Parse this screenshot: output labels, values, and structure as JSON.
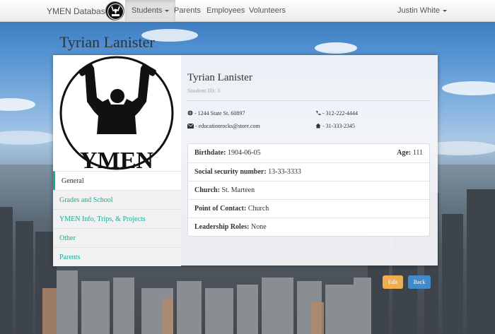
{
  "navbar": {
    "brand": "YMEN Database",
    "items": [
      {
        "label": "Students",
        "active": true,
        "dropdown": true
      },
      {
        "label": "Parents",
        "active": false
      },
      {
        "label": "Employees",
        "active": false
      },
      {
        "label": "Volunteers",
        "active": false
      }
    ],
    "user": "Justin White"
  },
  "page": {
    "title": "Tyrian Lanister"
  },
  "profile": {
    "name": "Tyrian Lanister",
    "student_id": "Student ID: 3",
    "address": "- 1244 State St. 60897",
    "email": "- educationrocks@store.com",
    "phone": "- 312-222-4444",
    "home_phone": "- 31-333-2345"
  },
  "logo_text": "YMEN",
  "side_menu": [
    {
      "label": "General",
      "active": true
    },
    {
      "label": "Grades and School",
      "active": false
    },
    {
      "label": "YMEN Info, Trips, & Projects",
      "active": false
    },
    {
      "label": "Other",
      "active": false
    },
    {
      "label": "Parents",
      "active": false
    }
  ],
  "details": {
    "birthdate_label": "Birthdate:",
    "birthdate": "1904-06-05",
    "age_label": "Age:",
    "age": "111",
    "ssn_label": "Social security number:",
    "ssn": "13-33-3333",
    "church_label": "Church:",
    "church": "St. Marteen",
    "contact_label": "Point of Contact:",
    "contact": "Church",
    "leadership_label": "Leadership Roles:",
    "leadership": "None"
  },
  "buttons": {
    "edit": "Edit",
    "back": "Back"
  },
  "colors": {
    "accent": "#1aa994",
    "edit": "#f0ad4e",
    "back": "#428bca"
  }
}
